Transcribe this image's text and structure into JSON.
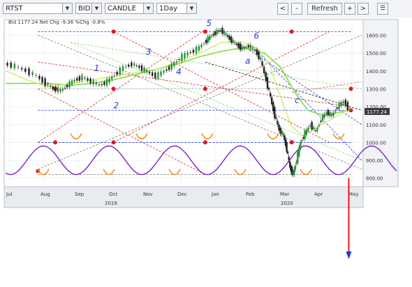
{
  "toolbar": {
    "symbol": "RTST",
    "price_type": "BID",
    "chart_style": "CANDLE",
    "interval": "1Day",
    "prev_label": "<",
    "dash_label": "-",
    "refresh_label": "Refresh",
    "plus_label": "+",
    "next_label": ">",
    "menu_icon": "list-icon"
  },
  "info": {
    "bid_text": "Bid 1177.24 Net Chg -9.36 %Chg -0.8%"
  },
  "chart_data": {
    "type": "candlestick",
    "title": "",
    "y_ticks": [
      1600,
      1500,
      1400,
      1300,
      1200,
      1100,
      1000,
      900,
      800
    ],
    "y_tick_labels": [
      "1600.00",
      "1500.00",
      "1400.00",
      "1300.00",
      "1200.00",
      "1100.00",
      "1000.00",
      "900.00",
      "800.00"
    ],
    "ylim": [
      760,
      1680
    ],
    "last_price_label": "1177.24",
    "x_month_labels": [
      "Jul",
      "Aug",
      "Sep",
      "Oct",
      "Nov",
      "Dec",
      "Jan",
      "Feb",
      "Mar",
      "Apr",
      "May"
    ],
    "x_year_labels": [
      "2019",
      "2020"
    ],
    "xlim_days": [
      0,
      330
    ],
    "series_close": [
      [
        0,
        1440
      ],
      [
        10,
        1425
      ],
      [
        20,
        1400
      ],
      [
        30,
        1370
      ],
      [
        38,
        1330
      ],
      [
        45,
        1300
      ],
      [
        52,
        1290
      ],
      [
        58,
        1320
      ],
      [
        65,
        1350
      ],
      [
        72,
        1365
      ],
      [
        80,
        1340
      ],
      [
        88,
        1320
      ],
      [
        95,
        1340
      ],
      [
        102,
        1380
      ],
      [
        110,
        1420
      ],
      [
        118,
        1440
      ],
      [
        125,
        1420
      ],
      [
        132,
        1395
      ],
      [
        140,
        1370
      ],
      [
        148,
        1400
      ],
      [
        155,
        1430
      ],
      [
        162,
        1470
      ],
      [
        170,
        1500
      ],
      [
        178,
        1520
      ],
      [
        185,
        1560
      ],
      [
        190,
        1590
      ],
      [
        195,
        1615
      ],
      [
        200,
        1630
      ],
      [
        205,
        1600
      ],
      [
        210,
        1570
      ],
      [
        215,
        1545
      ],
      [
        220,
        1525
      ],
      [
        226,
        1540
      ],
      [
        232,
        1515
      ],
      [
        237,
        1460
      ],
      [
        242,
        1350
      ],
      [
        246,
        1250
      ],
      [
        250,
        1150
      ],
      [
        254,
        1070
      ],
      [
        258,
        1040
      ],
      [
        261,
        960
      ],
      [
        264,
        860
      ],
      [
        267,
        820
      ],
      [
        270,
        900
      ],
      [
        274,
        1000
      ],
      [
        278,
        1050
      ],
      [
        283,
        1100
      ],
      [
        288,
        1060
      ],
      [
        293,
        1130
      ],
      [
        298,
        1170
      ],
      [
        303,
        1150
      ],
      [
        308,
        1200
      ],
      [
        314,
        1230
      ],
      [
        320,
        1177
      ]
    ],
    "series_ma_fast": [
      [
        0,
        1400
      ],
      [
        20,
        1350
      ],
      [
        40,
        1310
      ],
      [
        60,
        1330
      ],
      [
        80,
        1350
      ],
      [
        100,
        1370
      ],
      [
        120,
        1390
      ],
      [
        140,
        1410
      ],
      [
        160,
        1450
      ],
      [
        180,
        1500
      ],
      [
        200,
        1560
      ],
      [
        220,
        1560
      ],
      [
        235,
        1520
      ],
      [
        245,
        1430
      ],
      [
        255,
        1250
      ],
      [
        265,
        1090
      ],
      [
        275,
        1040
      ],
      [
        290,
        1090
      ],
      [
        305,
        1140
      ],
      [
        320,
        1190
      ]
    ],
    "series_ma_slow": [
      [
        0,
        1330
      ],
      [
        20,
        1330
      ],
      [
        40,
        1330
      ],
      [
        60,
        1320
      ],
      [
        80,
        1330
      ],
      [
        100,
        1350
      ],
      [
        120,
        1380
      ],
      [
        140,
        1410
      ],
      [
        160,
        1440
      ],
      [
        180,
        1480
      ],
      [
        200,
        1510
      ],
      [
        220,
        1530
      ],
      [
        240,
        1500
      ],
      [
        255,
        1420
      ],
      [
        268,
        1280
      ],
      [
        280,
        1180
      ],
      [
        295,
        1150
      ],
      [
        310,
        1170
      ],
      [
        320,
        1185
      ]
    ],
    "wave_labels": [
      "1",
      "2",
      "3",
      "4",
      "5",
      "6",
      "a",
      "c"
    ],
    "grid": true
  }
}
